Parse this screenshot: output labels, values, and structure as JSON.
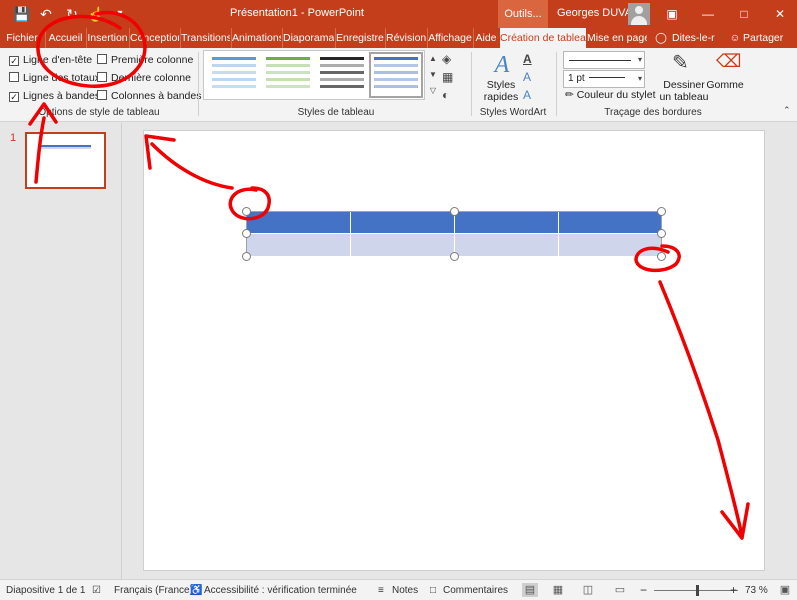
{
  "titlebar": {
    "doc_title": "Présentation1 - PowerPoint",
    "contextual_tools": "Outils...",
    "user_name": "Georges DUVAL",
    "save_icon": "save-icon",
    "undo_icon": "undo-icon",
    "redo_icon": "redo-icon",
    "touch_mode_icon": "touch-mode-icon",
    "customize_icon": "chevron-down-icon",
    "window_controls": [
      "ribbon-options-icon",
      "minimize-icon",
      "maximize-icon",
      "close-icon"
    ]
  },
  "tabs": [
    {
      "label": "Fichier"
    },
    {
      "label": "Accueil"
    },
    {
      "label": "Insertion"
    },
    {
      "label": "Conception"
    },
    {
      "label": "Transitions"
    },
    {
      "label": "Animations"
    },
    {
      "label": "Diaporama"
    },
    {
      "label": "Enregistrer"
    },
    {
      "label": "Révision"
    },
    {
      "label": "Affichage"
    },
    {
      "label": "Aide"
    },
    {
      "label": "Création de tableau"
    },
    {
      "label": "Mise en page"
    }
  ],
  "tell_me": "Dites-le-r",
  "share": "Partager",
  "ribbon": {
    "style_options": {
      "label": "Options de style de tableau",
      "items": [
        {
          "label": "Ligne d'en-tête",
          "checked": true
        },
        {
          "label": "Ligne des totaux",
          "checked": false
        },
        {
          "label": "Lignes à bandes",
          "checked": true
        },
        {
          "label": "Première colonne",
          "checked": false
        },
        {
          "label": "Dernière colonne",
          "checked": false
        },
        {
          "label": "Colonnes à bandes",
          "checked": false
        }
      ]
    },
    "table_styles": {
      "label": "Styles de tableau",
      "colors": [
        "#5b9bd5",
        "#70ad47",
        "#595959",
        "#4472c4"
      ]
    },
    "wordart": {
      "label": "Styles WordArt",
      "quick_styles": "Styles rapides"
    },
    "borders": {
      "label": "Traçage des bordures",
      "pen_weight": "1 pt",
      "pen_color": "Couleur du stylet",
      "draw_table": "Dessiner un tableau",
      "eraser": "Gomme"
    }
  },
  "slides_panel": {
    "slide_number": "1"
  },
  "statusbar": {
    "slide_info": "Diapositive 1 de 1",
    "language": "Français (France)",
    "accessibility": "Accessibilité : vérification terminée",
    "notes": "Notes",
    "comments": "Commentaires",
    "zoom_minus": "−",
    "zoom_plus": "+",
    "zoom": "73 %"
  },
  "colors": {
    "accent": "#c43e1c",
    "table_header": "#4472c4",
    "table_band": "#cfd5ea",
    "annotation": "#f00000"
  }
}
